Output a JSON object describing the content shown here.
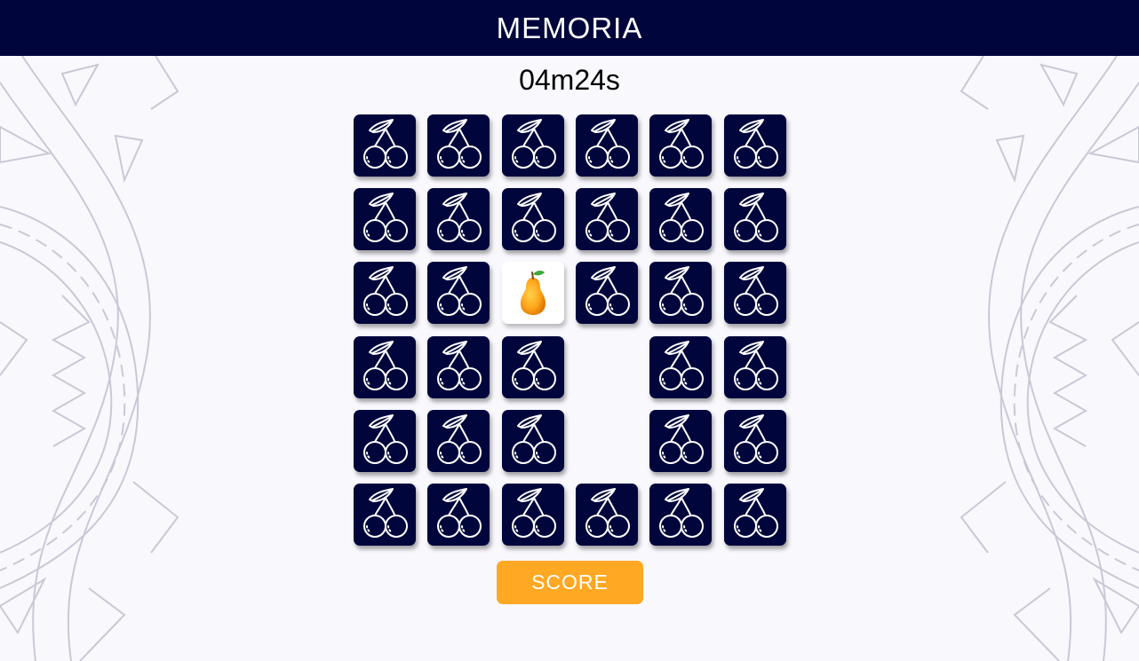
{
  "header": {
    "title": "MEMORIA"
  },
  "timer": {
    "value": "04m24s"
  },
  "board": {
    "rows": 6,
    "cols": 6,
    "back_icon": "cherry-icon",
    "revealed_icon": "pear-icon",
    "cards": [
      "hidden",
      "hidden",
      "hidden",
      "hidden",
      "hidden",
      "hidden",
      "hidden",
      "hidden",
      "hidden",
      "hidden",
      "hidden",
      "hidden",
      "hidden",
      "hidden",
      "revealed",
      "hidden",
      "hidden",
      "hidden",
      "hidden",
      "hidden",
      "hidden",
      "matched",
      "hidden",
      "hidden",
      "hidden",
      "hidden",
      "hidden",
      "matched",
      "hidden",
      "hidden",
      "hidden",
      "hidden",
      "hidden",
      "hidden",
      "hidden",
      "hidden"
    ]
  },
  "score_button": {
    "label": "SCORE"
  },
  "colors": {
    "header_bg": "#00063c",
    "card_back": "#00063c",
    "accent": "#ffa824",
    "page_bg": "#f8f8fd",
    "decoration": "#c9c9d6"
  }
}
